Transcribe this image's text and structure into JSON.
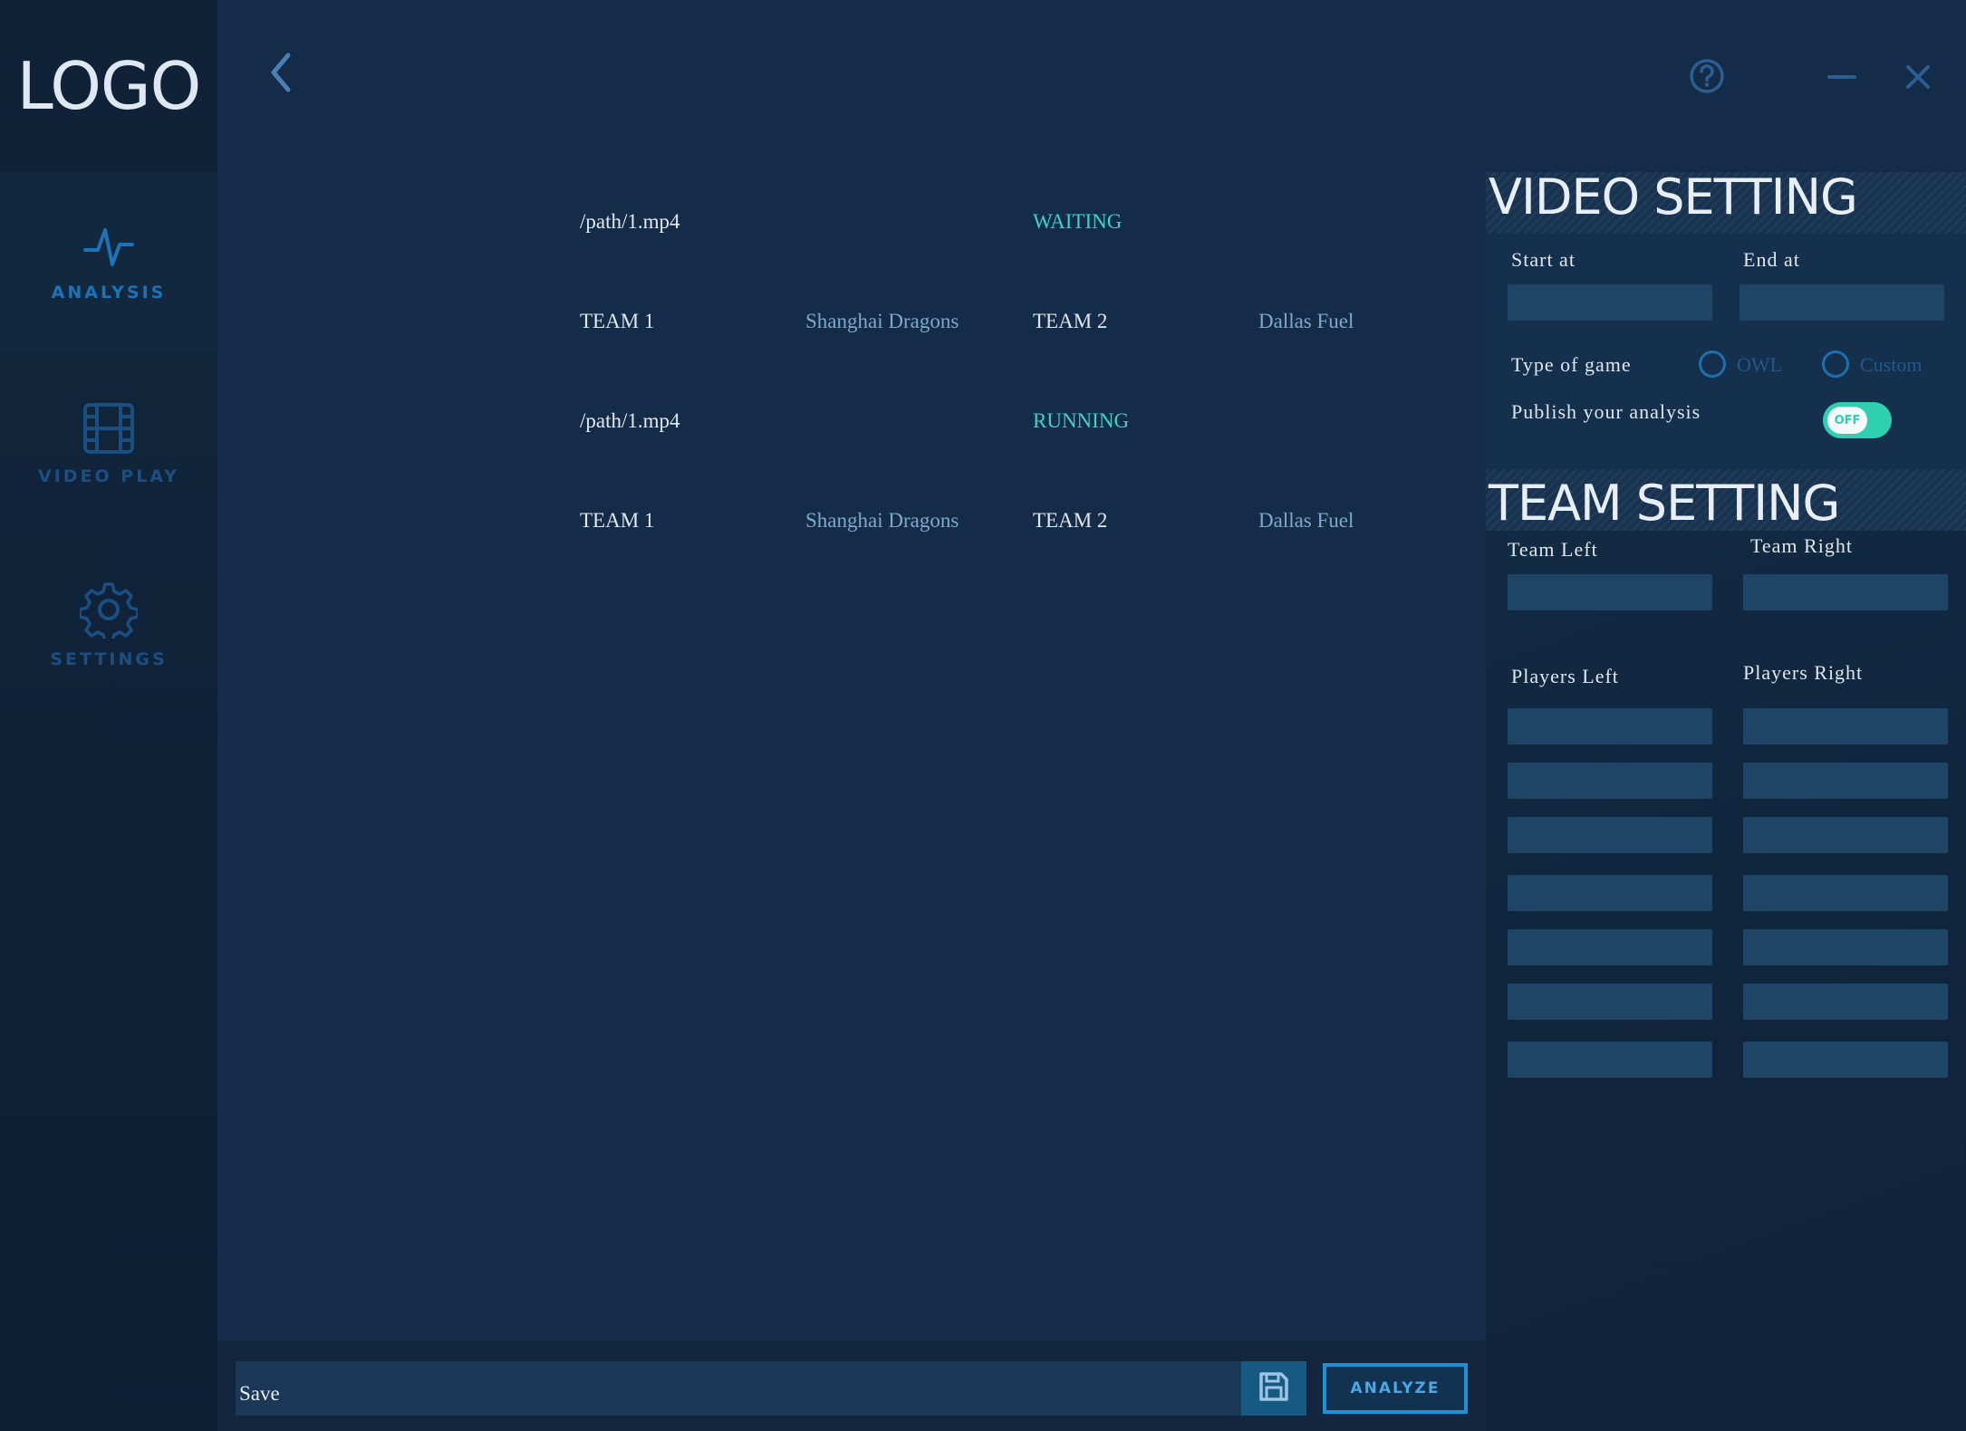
{
  "app": {
    "logo": "LOGO"
  },
  "sidebar": {
    "items": [
      {
        "label": "ANALYSIS",
        "icon": "pulse-icon",
        "active": true
      },
      {
        "label": "VIDEO PLAY",
        "icon": "film-icon",
        "active": false
      },
      {
        "label": "SETTINGS",
        "icon": "gear-icon",
        "active": false
      }
    ]
  },
  "topbar": {
    "back_icon": "chevron-left-icon",
    "help_icon": "help-icon",
    "minimize_icon": "minimize-icon",
    "close_icon": "close-icon"
  },
  "jobs": [
    {
      "path": "/path/1.mp4",
      "status": "WAITING",
      "team1_label": "TEAM 1",
      "team1_name": "Shanghai Dragons",
      "team2_label": "TEAM 2",
      "team2_name": "Dallas Fuel"
    },
    {
      "path": "/path/1.mp4",
      "status": "RUNNING",
      "team1_label": "TEAM 1",
      "team1_name": "Shanghai Dragons",
      "team2_label": "TEAM 2",
      "team2_name": "Dallas Fuel"
    }
  ],
  "bottom": {
    "save_placeholder": "Save",
    "save_icon": "floppy-disk-icon",
    "analyze_label": "ANALYZE"
  },
  "video_setting": {
    "title": "VIDEO SETTING",
    "start_label": "Start at",
    "start_value": "",
    "end_label": "End at",
    "end_value": "",
    "game_type_label": "Type of game",
    "game_type_options": [
      "OWL",
      "Custom"
    ],
    "publish_label": "Publish your analysis",
    "publish_toggle": "OFF"
  },
  "team_setting": {
    "title": "TEAM SETTING",
    "team_left_label": "Team Left",
    "team_right_label": "Team Right",
    "players_left_label": "Players Left",
    "players_right_label": "Players Right",
    "players_left": [
      "",
      "",
      "",
      "",
      "",
      "",
      ""
    ],
    "players_right": [
      "",
      "",
      "",
      "",
      "",
      "",
      ""
    ]
  },
  "colors": {
    "background": "#142c47",
    "accent": "#1e90d6",
    "status": "#3fd3c4",
    "toggle": "#2fd0b0"
  }
}
